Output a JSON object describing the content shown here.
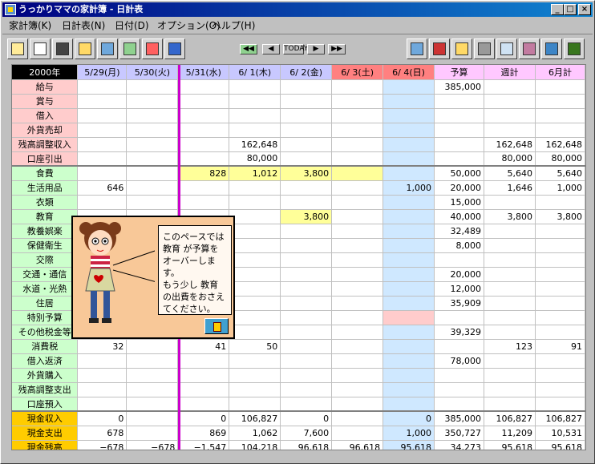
{
  "window": {
    "title": "うっかりママの家計簿 - 日計表"
  },
  "menu": [
    "家計簿(K)",
    "日計表(N)",
    "日付(D)",
    "オプション(O)",
    "ヘルプ(H)"
  ],
  "nav": {
    "today_label": "TODAY"
  },
  "toolbar_icons": [
    "edit-icon",
    "journal-icon",
    "calculator-icon",
    "calendar-icon",
    "photo-icon",
    "graph-icon",
    "sale-icon",
    "person-icon"
  ],
  "toolbar_right_icons": [
    "balance-icon",
    "household-icon",
    "bank-icon",
    "printer-icon",
    "copy-icon",
    "woman-icon",
    "book-icon",
    "exit-icon"
  ],
  "grid": {
    "year": "2000年",
    "days": [
      "5/29(月)",
      "5/30(火)",
      "5/31(水)",
      "6/ 1(木)",
      "6/ 2(金)",
      "6/ 3(土)",
      "6/ 4(日)"
    ],
    "summary_cols": [
      "予算",
      "週計",
      "6月計"
    ],
    "income_rows": [
      {
        "label": "給与",
        "cells": [
          "",
          "",
          "",
          "",
          "",
          "",
          "",
          "385,000",
          "",
          ""
        ]
      },
      {
        "label": "賞与",
        "cells": [
          "",
          "",
          "",
          "",
          "",
          "",
          "",
          "",
          "",
          ""
        ]
      },
      {
        "label": "借入",
        "cells": [
          "",
          "",
          "",
          "",
          "",
          "",
          "",
          "",
          "",
          ""
        ]
      },
      {
        "label": "外貨売却",
        "cells": [
          "",
          "",
          "",
          "",
          "",
          "",
          "",
          "",
          "",
          ""
        ]
      },
      {
        "label": "残高調整収入",
        "cells": [
          "",
          "",
          "",
          "162,648",
          "",
          "",
          "",
          "",
          "162,648",
          "162,648"
        ]
      },
      {
        "label": "口座引出",
        "cells": [
          "",
          "",
          "",
          "80,000",
          "",
          "",
          "",
          "",
          "80,000",
          "80,000"
        ]
      }
    ],
    "expense_rows": [
      {
        "label": "食費",
        "cells": [
          "",
          "",
          "828",
          "1,012",
          "3,800",
          "",
          "",
          "50,000",
          "5,640",
          "5,640"
        ]
      },
      {
        "label": "生活用品",
        "cells": [
          "646",
          "",
          "",
          "",
          "",
          "",
          "1,000",
          "20,000",
          "1,646",
          "1,000"
        ]
      },
      {
        "label": "衣類",
        "cells": [
          "",
          "",
          "",
          "",
          "",
          "",
          "",
          "15,000",
          "",
          ""
        ]
      },
      {
        "label": "教育",
        "cells": [
          "",
          "",
          "",
          "",
          "3,800",
          "",
          "",
          "40,000",
          "3,800",
          "3,800"
        ]
      },
      {
        "label": "教養娯楽",
        "cells": [
          "",
          "",
          "",
          "",
          "",
          "",
          "",
          "32,489",
          "",
          ""
        ]
      },
      {
        "label": "保健衛生",
        "cells": [
          "",
          "",
          "",
          "",
          "",
          "",
          "",
          "8,000",
          "",
          ""
        ]
      },
      {
        "label": "交際",
        "cells": [
          "",
          "",
          "",
          "",
          "",
          "",
          "",
          "",
          "",
          ""
        ]
      },
      {
        "label": "交通・通信",
        "cells": [
          "",
          "",
          "",
          "",
          "",
          "",
          "",
          "20,000",
          "",
          ""
        ]
      },
      {
        "label": "水道・光熱",
        "cells": [
          "",
          "",
          "",
          "",
          "",
          "",
          "",
          "12,000",
          "",
          ""
        ]
      },
      {
        "label": "住居",
        "cells": [
          "",
          "",
          "",
          "",
          "",
          "",
          "",
          "35,909",
          "",
          ""
        ]
      },
      {
        "label": "特別予算",
        "cells": [
          "",
          "",
          "",
          "",
          "",
          "",
          "",
          "",
          "",
          ""
        ]
      },
      {
        "label": "その他税金等",
        "cells": [
          "",
          "",
          "",
          "",
          "",
          "",
          "",
          "39,329",
          "",
          ""
        ]
      },
      {
        "label": "消費税",
        "cells": [
          "32",
          "",
          "41",
          "50",
          "",
          "",
          "",
          "",
          "123",
          "91"
        ]
      },
      {
        "label": "借入返済",
        "cells": [
          "",
          "",
          "",
          "",
          "",
          "",
          "",
          "78,000",
          "",
          ""
        ]
      },
      {
        "label": "外貨購入",
        "cells": [
          "",
          "",
          "",
          "",
          "",
          "",
          "",
          "",
          "",
          ""
        ]
      },
      {
        "label": "残高調整支出",
        "cells": [
          "",
          "",
          "",
          "",
          "",
          "",
          "",
          "",
          "",
          ""
        ]
      },
      {
        "label": "口座預入",
        "cells": [
          "",
          "",
          "",
          "",
          "",
          "",
          "",
          "",
          "",
          ""
        ]
      }
    ],
    "total_rows": [
      {
        "label": "現金収入",
        "cells": [
          "0",
          "",
          "0",
          "106,827",
          "0",
          "",
          "0",
          "385,000",
          "106,827",
          "106,827"
        ]
      },
      {
        "label": "現金支出",
        "cells": [
          "678",
          "",
          "869",
          "1,062",
          "7,600",
          "",
          "1,000",
          "350,727",
          "11,209",
          "10,531"
        ]
      },
      {
        "label": "現金残高",
        "cells": [
          "−678",
          "−678",
          "−1,547",
          "104,218",
          "96,618",
          "96,618",
          "95,618",
          "34,273",
          "95,618",
          "95,618"
        ]
      }
    ]
  },
  "popup": {
    "message_lines": [
      "このペースでは",
      "教育 が予算を",
      "オーバーします。",
      "もう少し 教育",
      "の出費をおさえ",
      "てください。"
    ]
  },
  "colors": {
    "accent": "#000080",
    "today_line": "#cc00cc",
    "income": "#ffcccc",
    "expense": "#ccffcc",
    "total": "#ffcc00"
  }
}
